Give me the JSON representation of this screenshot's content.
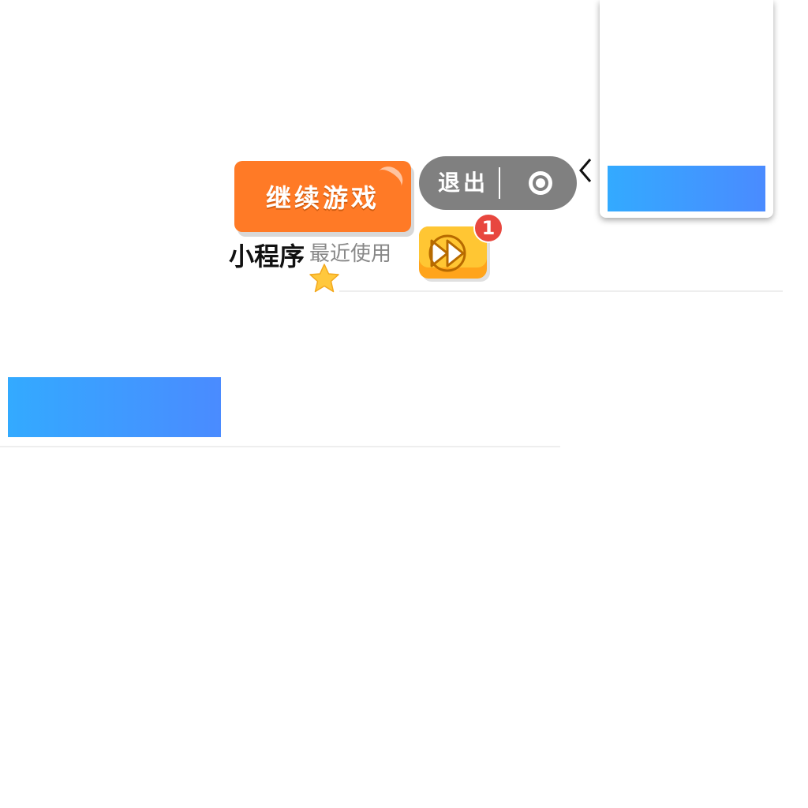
{
  "continue_button": {
    "label": "继续游戏",
    "color": "#ff7a26"
  },
  "capsule": {
    "exit_label": "退出",
    "color": "#808080"
  },
  "game_button": {
    "badge_count": "1",
    "color": "#ffb824"
  },
  "mini_program": {
    "title": "小程序",
    "subtitle": "最近使用"
  },
  "icons": {
    "target": "target-icon",
    "chevron": "chevron-left-icon",
    "fast_forward": "fast-forward-icon",
    "star": "star-icon"
  },
  "colors": {
    "blue_start": "#33aaff",
    "blue_end": "#4a8bff",
    "star": "#ffc83d",
    "badge": "#e8473f"
  }
}
